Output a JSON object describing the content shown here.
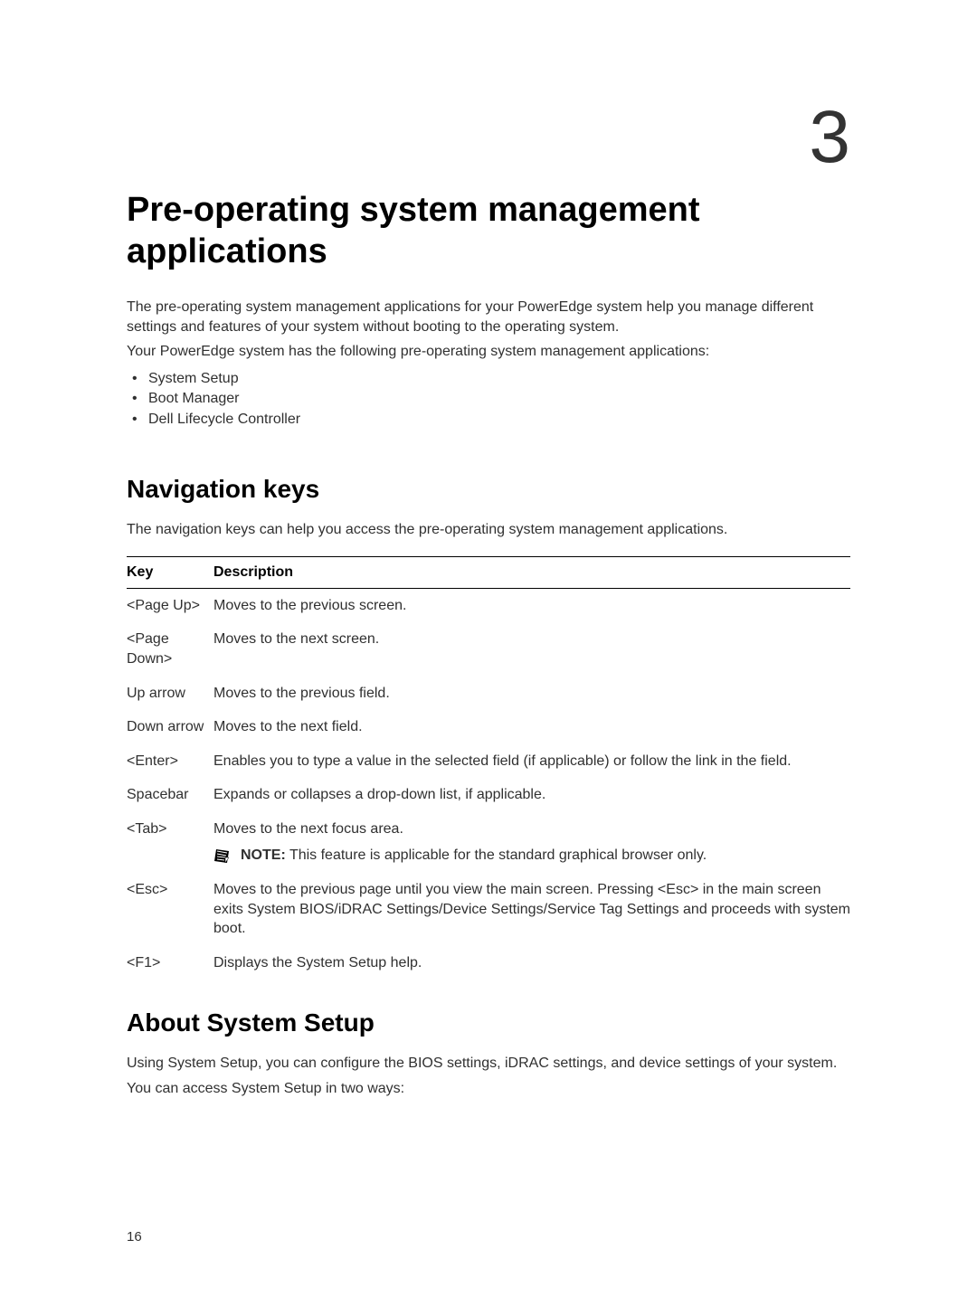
{
  "chapter_number": "3",
  "title": "Pre-operating system management applications",
  "intro": {
    "p1": "The pre-operating system management applications for your PowerEdge system help you manage different settings and features of your system without booting to the operating system.",
    "p2": "Your PowerEdge system has the following pre-operating system management applications:"
  },
  "apps": [
    "System Setup",
    "Boot Manager",
    "Dell Lifecycle Controller"
  ],
  "nav_heading": "Navigation keys",
  "nav_intro": "The navigation keys can help you access the pre-operating system management applications.",
  "table": {
    "col1": "Key",
    "col2": "Description",
    "rows": [
      {
        "key": "<Page Up>",
        "desc": "Moves to the previous screen."
      },
      {
        "key": "<Page Down>",
        "desc": "Moves to the next screen."
      },
      {
        "key": "Up arrow",
        "desc": "Moves to the previous field."
      },
      {
        "key": "Down arrow",
        "desc": "Moves to the next field."
      },
      {
        "key": "<Enter>",
        "desc": "Enables you to type a value in the selected field (if applicable) or follow the link in the field."
      },
      {
        "key": "Spacebar",
        "desc": "Expands or collapses a drop-down list, if applicable."
      },
      {
        "key": "<Tab>",
        "desc": "Moves to the next focus area.",
        "note_label": "NOTE:",
        "note": " This feature is applicable for the standard graphical browser only."
      },
      {
        "key": "<Esc>",
        "desc": "Moves to the previous page until you view the main screen. Pressing <Esc> in the main screen exits System BIOS/iDRAC Settings/Device Settings/Service Tag Settings and proceeds with system boot."
      },
      {
        "key": "<F1>",
        "desc": "Displays the System Setup help."
      }
    ]
  },
  "about_heading": "About System Setup",
  "about": {
    "p1": "Using System Setup, you can configure the BIOS settings, iDRAC settings, and device settings of your system.",
    "p2": "You can access System Setup in two ways:"
  },
  "page_number": "16"
}
